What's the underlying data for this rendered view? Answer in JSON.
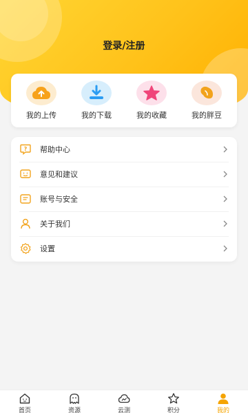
{
  "header": {
    "login_label": "登录/注册"
  },
  "quick_actions": [
    {
      "label": "我的上传",
      "icon": "cloud-upload-icon",
      "color": "#f7a21b"
    },
    {
      "label": "我的下载",
      "icon": "download-icon",
      "color": "#2b9cf2"
    },
    {
      "label": "我的收藏",
      "icon": "star-icon",
      "color": "#f0457a"
    },
    {
      "label": "我的胖豆",
      "icon": "bean-icon",
      "color": "#f2a31c"
    }
  ],
  "menu": [
    {
      "label": "帮助中心",
      "icon": "help-icon"
    },
    {
      "label": "意见和建议",
      "icon": "feedback-icon"
    },
    {
      "label": "账号与安全",
      "icon": "account-security-icon"
    },
    {
      "label": "关于我们",
      "icon": "user-icon"
    },
    {
      "label": "设置",
      "icon": "gear-icon"
    }
  ],
  "tabbar": [
    {
      "label": "首页",
      "icon": "home-icon",
      "active": false
    },
    {
      "label": "资源",
      "icon": "ghost-icon",
      "active": false
    },
    {
      "label": "云测",
      "icon": "cloud-icon",
      "active": false
    },
    {
      "label": "积分",
      "icon": "star-outline-icon",
      "active": false
    },
    {
      "label": "我的",
      "icon": "profile-icon",
      "active": true
    }
  ],
  "colors": {
    "accent": "#ffc21a",
    "menu_icon": "#f2a31c",
    "active_tab": "#f5a400"
  }
}
